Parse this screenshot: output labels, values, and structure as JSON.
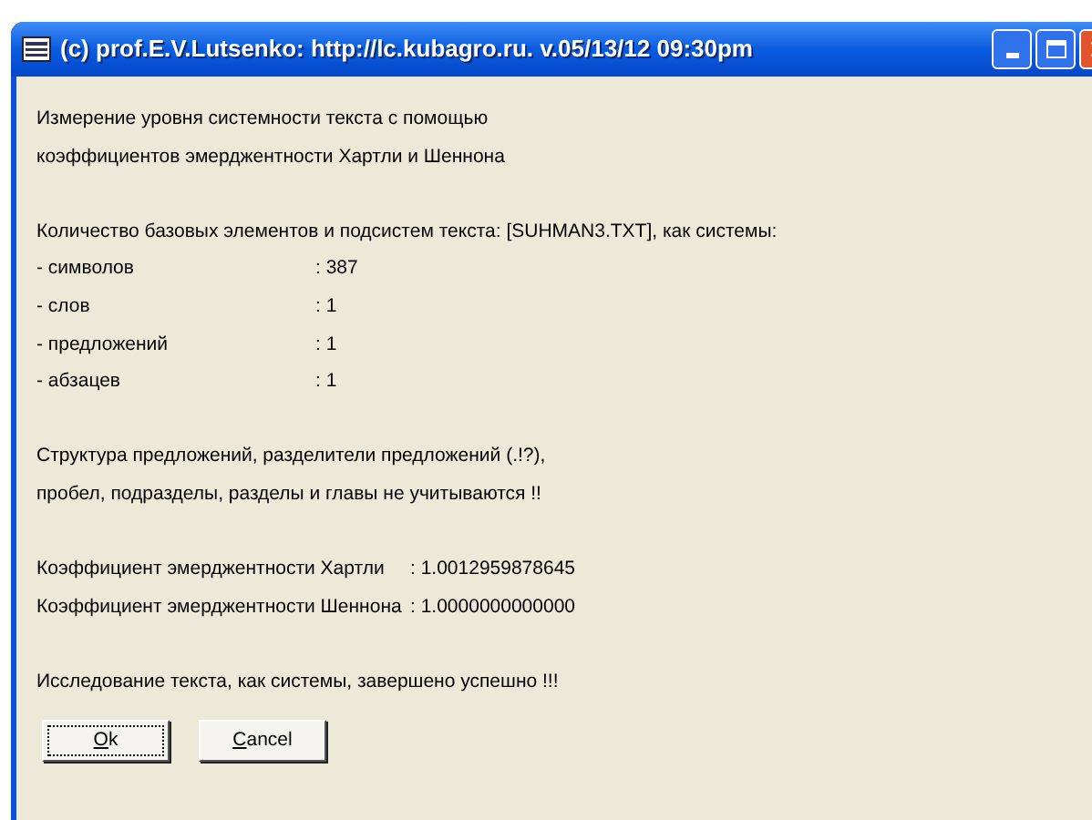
{
  "window": {
    "title": "(c) prof.E.V.Lutsenko: http://lc.kubagro.ru. v.05/13/12 09:30pm"
  },
  "intro": [
    "Измерение уровня системности текста с помощью",
    "коэффициентов эмерджентности Хартли и Шеннона"
  ],
  "counts": {
    "heading": "Количество базовых элементов и подсистем текста: [SUHMAN3.TXT], как системы:",
    "rows": [
      {
        "label": "- символов",
        "value": ": 387"
      },
      {
        "label": "- слов",
        "value": ": 1"
      },
      {
        "label": "- предложений",
        "value": ": 1"
      },
      {
        "label": "- абзацев",
        "value": ": 1"
      }
    ]
  },
  "note": [
    "Структура предложений, разделители предложений (.!?),",
    "пробел, подразделы, разделы и главы не учитываются !!"
  ],
  "coefficients": [
    {
      "label": "Коэффициент эмерджентности Хартли",
      "value": ": 1.0012959878645"
    },
    {
      "label": "Коэффициент эмерджентности Шеннона",
      "value": ": 1.0000000000000"
    }
  ],
  "result": "Исследование текста, как системы, завершено успешно !!!",
  "buttons": [
    {
      "label": "Ok",
      "focused": true
    },
    {
      "label": "Cancel",
      "focused": false
    }
  ]
}
